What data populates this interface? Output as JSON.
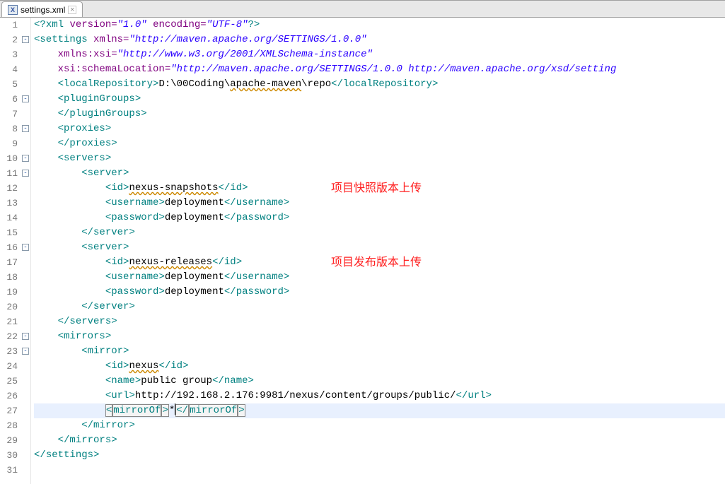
{
  "tab": {
    "title": "settings.xml",
    "icon": "X",
    "close": "×"
  },
  "annotations": {
    "a1": "项目快照版本上传",
    "a2": "项目发布版本上传"
  },
  "gutter": {
    "lines": [
      "1",
      "2",
      "3",
      "4",
      "5",
      "6",
      "7",
      "8",
      "9",
      "10",
      "11",
      "12",
      "13",
      "14",
      "15",
      "16",
      "17",
      "18",
      "19",
      "20",
      "21",
      "22",
      "23",
      "24",
      "25",
      "26",
      "27",
      "28",
      "29",
      "30",
      "31"
    ],
    "fold": {
      "2": "-",
      "6": "-",
      "8": "-",
      "10": "-",
      "11": "-",
      "16": "-",
      "22": "-",
      "23": "-"
    }
  },
  "xml": {
    "pi_open": "<?",
    "pi_end": "?>",
    "lt": "<",
    "gt": ">",
    "lts": "</",
    "xml": "xml",
    "version_attr": "version=",
    "version_val": "\"1.0\"",
    "encoding_attr": "encoding=",
    "encoding_val": "\"UTF-8\"",
    "settings": "settings",
    "xmlns_attr": "xmlns=",
    "xmlns_val": "\"http://maven.apache.org/SETTINGS/1.0.0\"",
    "xmlns_xsi_attr": "xmlns:xsi=",
    "xmlns_xsi_val": "\"http://www.w3.org/2001/XMLSchema-instance\"",
    "xsi_loc_attr": "xsi:schemaLocation=",
    "xsi_loc_val": "\"http://maven.apache.org/SETTINGS/1.0.0 http://maven.apache.org/xsd/setting",
    "localRepository": "localRepository",
    "localRepo_val": "D:\\00Coding\\apache-maven\\repo",
    "localRepo_prefix": "D:\\00Coding\\",
    "localRepo_mid": "apache-maven",
    "localRepo_suffix": "\\repo",
    "pluginGroups": "pluginGroups",
    "proxies": "proxies",
    "servers": "servers",
    "server": "server",
    "id": "id",
    "id_snap": "nexus-snapshots",
    "id_rel": "nexus-releases",
    "id_nexus": "nexus",
    "username": "username",
    "user_val": "deployment",
    "password": "password",
    "pass_val": "deployment",
    "mirrors": "mirrors",
    "mirror": "mirror",
    "name": "name",
    "name_val": "public group",
    "url": "url",
    "url_val": "http://192.168.2.176:9981/nexus/content/groups/public/",
    "mirrorOf": "mirrorOf",
    "mirrorOf_val": "*"
  }
}
